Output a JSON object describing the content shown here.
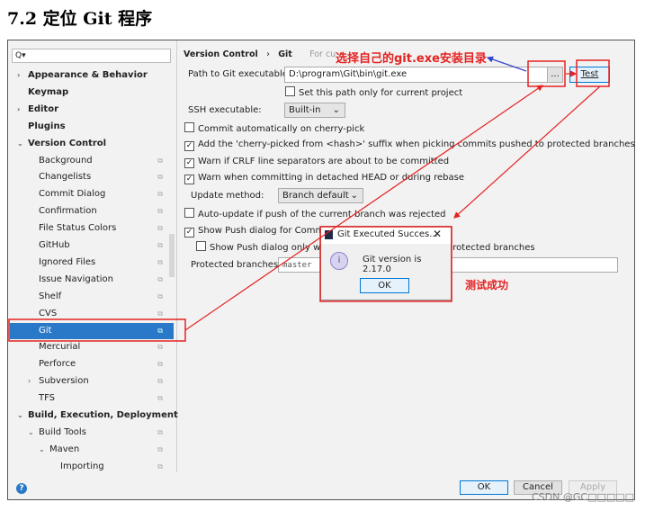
{
  "heading": "7.2  定位 Git 程序",
  "search": {
    "placeholder": "Q▾"
  },
  "sidebar": {
    "items": [
      {
        "label": "Appearance & Behavior"
      },
      {
        "label": "Keymap"
      },
      {
        "label": "Editor"
      },
      {
        "label": "Plugins"
      },
      {
        "label": "Version Control"
      },
      {
        "label": "Background"
      },
      {
        "label": "Changelists"
      },
      {
        "label": "Commit Dialog"
      },
      {
        "label": "Confirmation"
      },
      {
        "label": "File Status Colors"
      },
      {
        "label": "GitHub"
      },
      {
        "label": "Ignored Files"
      },
      {
        "label": "Issue Navigation"
      },
      {
        "label": "Shelf"
      },
      {
        "label": "CVS"
      },
      {
        "label": "Git"
      },
      {
        "label": "Mercurial"
      },
      {
        "label": "Perforce"
      },
      {
        "label": "Subversion"
      },
      {
        "label": "TFS"
      },
      {
        "label": "Build, Execution, Deployment"
      },
      {
        "label": "Build Tools"
      },
      {
        "label": "Maven"
      },
      {
        "label": "Importing"
      }
    ]
  },
  "breadcrumb": {
    "parent": "Version Control",
    "sep": "›",
    "current": "Git",
    "scope": "For cu"
  },
  "settings": {
    "path_label": "Path to Git executable:",
    "path_value": "D:\\program\\Git\\bin\\git.exe",
    "browse": "...",
    "test": "Test",
    "set_path_only": "Set this path only for current project",
    "ssh_label": "SSH executable:",
    "ssh_value": "Built-in",
    "commit_auto": "Commit automatically on cherry-pick",
    "add_suffix": "Add the 'cherry-picked from <hash>' suffix when picking commits pushed to protected branches",
    "warn_crlf": "Warn if CRLF line separators are about to be committed",
    "warn_detached": "Warn when committing in detached HEAD or during rebase",
    "update_label": "Update method:",
    "update_value": "Branch default",
    "auto_update": "Auto-update if push of the current branch was rejected",
    "show_push": "Show Push dialog for Commit and Push",
    "show_push_only": "Show Push dialog only when commits are pushed to protected branches",
    "protected_label": "Protected branches:",
    "protected_value": "master"
  },
  "dialog": {
    "title": "Git Executed Succes...",
    "message": "Git version is 2.17.0",
    "ok": "OK"
  },
  "footer": {
    "ok": "OK",
    "cancel": "Cancel",
    "apply": "Apply"
  },
  "annotations": {
    "choose_dir": "选择自己的git.exe安装目录",
    "test_success": "测试成功"
  },
  "watermark": "CSDN @GC□□□□□"
}
